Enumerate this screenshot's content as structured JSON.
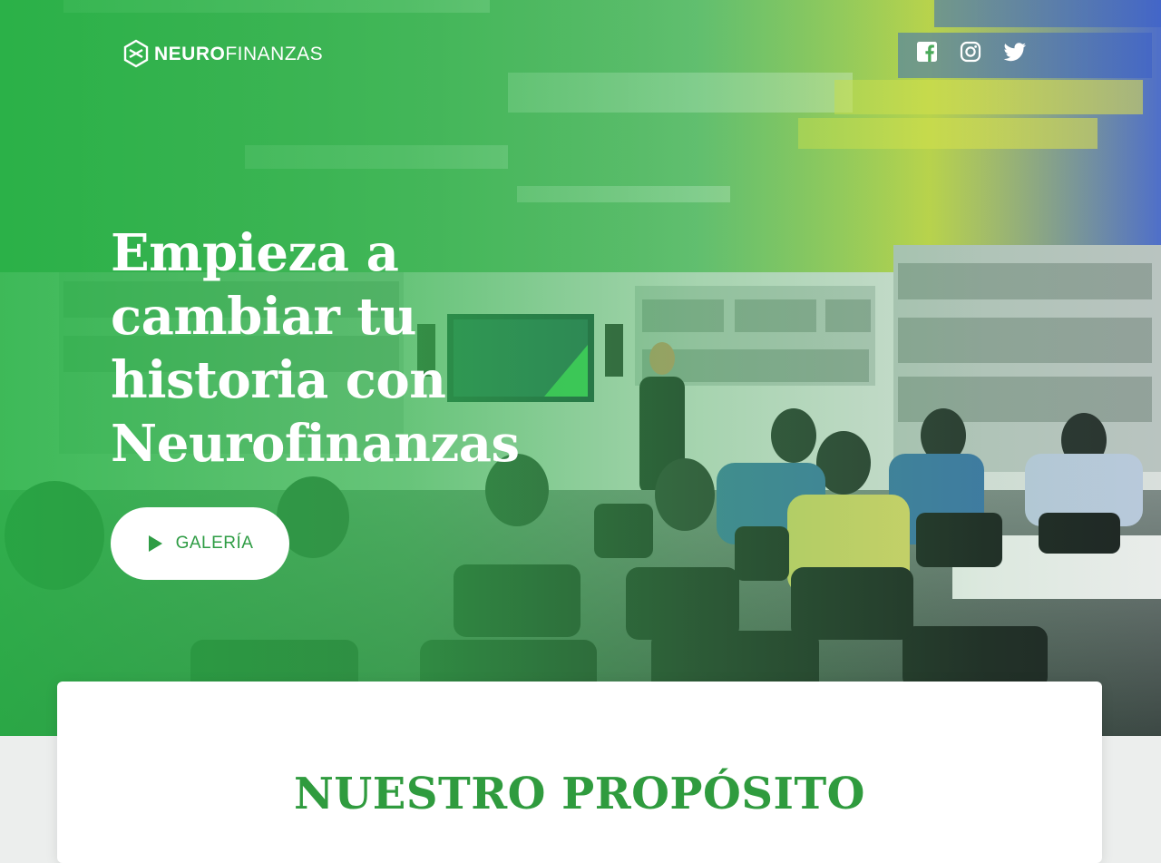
{
  "header": {
    "logo": {
      "bold": "NEURO",
      "light": "FINANZAS",
      "mark": "hexagon-logo"
    },
    "social": [
      {
        "name": "facebook",
        "icon": "facebook-icon"
      },
      {
        "name": "instagram",
        "icon": "instagram-icon"
      },
      {
        "name": "twitter",
        "icon": "twitter-icon"
      }
    ]
  },
  "hero": {
    "headline": "Empieza a cambiar tu historia con Neurofinanzas",
    "cta_label": "GALERÍA",
    "cta_icon": "play-icon"
  },
  "purpose": {
    "title": "NUESTRO PROPÓSITO"
  },
  "colors": {
    "brand_green": "#2f9b3e",
    "overlay_green": "#2db34a",
    "white": "#ffffff"
  }
}
